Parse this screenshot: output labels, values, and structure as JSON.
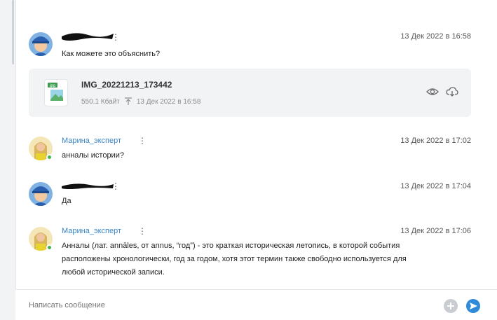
{
  "messages": [
    {
      "author": "",
      "time": "13 Дек 2022 в 16:58",
      "text": "Как можете это объяснить?"
    },
    {
      "author": "Марина_эксперт",
      "time": "13 Дек 2022 в 17:02",
      "text": "анналы истории?"
    },
    {
      "author": "",
      "time": "13 Дек 2022 в 17:04",
      "text": "Да"
    },
    {
      "author": "Марина_эксперт",
      "time": "13 Дек 2022 в 17:06",
      "text_lines": [
        "Анналы (лат. annāles, от annus, “год”) - это краткая историческая летопись, в которой события",
        "расположены хронологически, год за годом, хотя этот термин также свободно используется для",
        "любой исторической записи."
      ]
    }
  ],
  "file": {
    "name": "IMG_20221213_173442",
    "size": "550.1 Кбайт",
    "date": "13 Дек 2022 в 16:58",
    "ext": "jpg"
  },
  "composer": {
    "placeholder": "Написать сообщение"
  },
  "icons": {
    "more": "more-vertical-icon",
    "upload": "upload-icon",
    "view": "eye-icon",
    "download": "cloud-download-icon",
    "add": "plus-icon",
    "send": "send-icon"
  },
  "colors": {
    "accent": "#2f8ad8",
    "author": "#3a86c6",
    "online": "#43b552"
  }
}
